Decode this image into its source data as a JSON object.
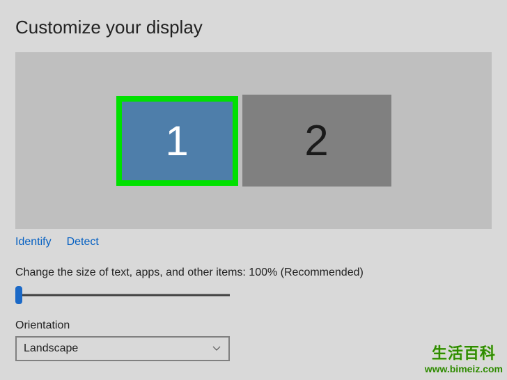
{
  "title": "Customize your display",
  "displays": {
    "monitor1": {
      "label": "1",
      "selected": true
    },
    "monitor2": {
      "label": "2",
      "selected": false
    }
  },
  "links": {
    "identify": "Identify",
    "detect": "Detect"
  },
  "scale": {
    "label": "Change the size of text, apps, and other items: 100% (Recommended)"
  },
  "orientation": {
    "label": "Orientation",
    "selected": "Landscape"
  },
  "watermark": {
    "text": "生活百科",
    "url": "www.bimeiz.com"
  }
}
